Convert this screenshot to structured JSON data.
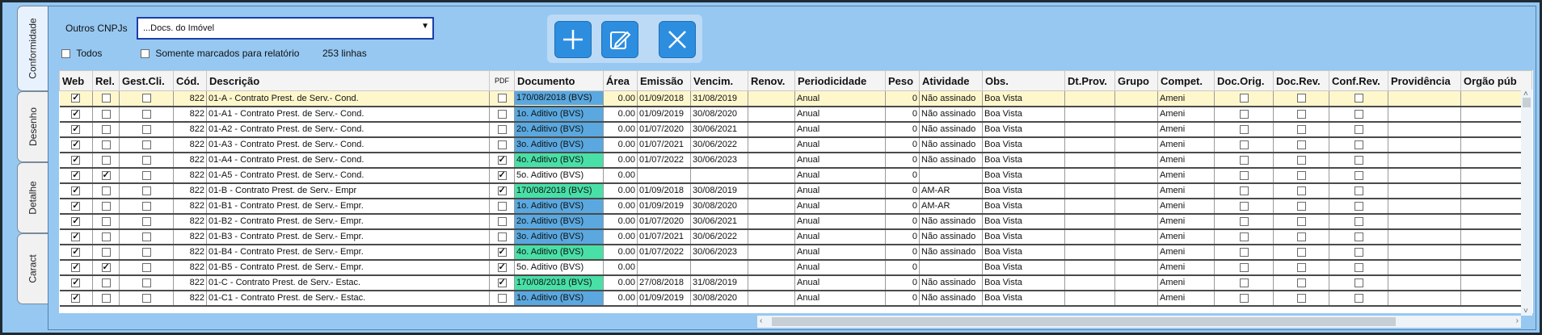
{
  "tabs": [
    {
      "label": "Conformidade",
      "active": true
    },
    {
      "label": "Desenho",
      "active": false
    },
    {
      "label": "Detalhe",
      "active": false
    },
    {
      "label": "Caract",
      "active": false
    }
  ],
  "filters": {
    "cnpj_label": "Outros CNPJs",
    "cnpj_value": "...Docs. do Imóvel",
    "todos_label": "Todos",
    "somente_label": "Somente marcados para relatório",
    "row_count": "253 linhas"
  },
  "toolbar": {
    "add": "plus-icon",
    "edit": "edit-icon",
    "close": "close-icon"
  },
  "colors": {
    "selected_row": "#fff7cc",
    "doc_blue": "#5aa8df",
    "doc_green": "#49e0a8",
    "background": "#96c8f2"
  },
  "columns": [
    "Web",
    "Rel.",
    "Gest.Cli.",
    "Cód.",
    "Descrição",
    "PDF",
    "Documento",
    "Área",
    "Emissão",
    "Vencim.",
    "Renov.",
    "Periodicidade",
    "Peso",
    "Atividade",
    "Obs.",
    "Dt.Prov.",
    "Grupo",
    "Compet.",
    "Doc.Orig.",
    "Doc.Rev.",
    "Conf.Rev.",
    "Providência",
    "Orgão púb"
  ],
  "rows": [
    {
      "web": true,
      "rel": false,
      "cod": "822",
      "desc": "01-A - Contrato Prest. de Serv.- Cond.",
      "pdf": false,
      "doc": "170/08/2018 (BVS)",
      "hl": "blue",
      "area": "0.00",
      "emissao": "01/09/2018",
      "venc": "31/08/2019",
      "period": "Anual",
      "peso": "0",
      "ativ": "Não assinado",
      "obs": "Boa Vista",
      "compet": "Ameni"
    },
    {
      "web": true,
      "rel": false,
      "cod": "822",
      "desc": "01-A1 - Contrato Prest. de Serv.- Cond.",
      "pdf": false,
      "doc": "1o. Aditivo (BVS)",
      "hl": "blue",
      "area": "0.00",
      "emissao": "01/09/2019",
      "venc": "30/08/2020",
      "period": "Anual",
      "peso": "0",
      "ativ": "Não assinado",
      "obs": "Boa Vista",
      "compet": "Ameni"
    },
    {
      "web": true,
      "rel": false,
      "cod": "822",
      "desc": "01-A2 - Contrato Prest. de Serv.- Cond.",
      "pdf": false,
      "doc": "2o. Aditivo (BVS)",
      "hl": "blue",
      "area": "0.00",
      "emissao": "01/07/2020",
      "venc": "30/06/2021",
      "period": "Anual",
      "peso": "0",
      "ativ": "Não assinado",
      "obs": "Boa Vista",
      "compet": "Ameni"
    },
    {
      "web": true,
      "rel": false,
      "cod": "822",
      "desc": "01-A3 - Contrato Prest. de Serv.- Cond.",
      "pdf": false,
      "doc": "3o. Aditivo (BVS)",
      "hl": "blue",
      "area": "0.00",
      "emissao": "01/07/2021",
      "venc": "30/06/2022",
      "period": "Anual",
      "peso": "0",
      "ativ": "Não assinado",
      "obs": "Boa Vista",
      "compet": "Ameni"
    },
    {
      "web": true,
      "rel": false,
      "cod": "822",
      "desc": "01-A4 - Contrato Prest. de Serv.- Cond.",
      "pdf": true,
      "doc": "4o. Aditivo (BVS)",
      "hl": "green",
      "area": "0.00",
      "emissao": "01/07/2022",
      "venc": "30/06/2023",
      "period": "Anual",
      "peso": "0",
      "ativ": "Não assinado",
      "obs": "Boa Vista",
      "compet": "Ameni"
    },
    {
      "web": true,
      "rel": true,
      "cod": "822",
      "desc": "01-A5 - Contrato Prest. de Serv.- Cond.",
      "pdf": true,
      "doc": "5o. Aditivo (BVS)",
      "hl": "",
      "area": "0.00",
      "emissao": "",
      "venc": "",
      "period": "Anual",
      "peso": "0",
      "ativ": "",
      "obs": "Boa Vista",
      "compet": "Ameni"
    },
    {
      "web": true,
      "rel": false,
      "cod": "822",
      "desc": "01-B - Contrato Prest. de Serv.- Empr",
      "pdf": true,
      "doc": "170/08/2018 (BVS)",
      "hl": "green",
      "area": "0.00",
      "emissao": "01/09/2018",
      "venc": "30/08/2019",
      "period": "Anual",
      "peso": "0",
      "ativ": "AM-AR",
      "obs": "Boa Vista",
      "compet": "Ameni"
    },
    {
      "web": true,
      "rel": false,
      "cod": "822",
      "desc": "01-B1 - Contrato Prest. de Serv.- Empr.",
      "pdf": false,
      "doc": "1o. Aditivo (BVS)",
      "hl": "blue",
      "area": "0.00",
      "emissao": "01/09/2019",
      "venc": "30/08/2020",
      "period": "Anual",
      "peso": "0",
      "ativ": "AM-AR",
      "obs": "Boa Vista",
      "compet": "Ameni"
    },
    {
      "web": true,
      "rel": false,
      "cod": "822",
      "desc": "01-B2 - Contrato Prest. de Serv.- Empr.",
      "pdf": false,
      "doc": "2o. Aditivo (BVS)",
      "hl": "blue",
      "area": "0.00",
      "emissao": "01/07/2020",
      "venc": "30/06/2021",
      "period": "Anual",
      "peso": "0",
      "ativ": "Não assinado",
      "obs": "Boa Vista",
      "compet": "Ameni"
    },
    {
      "web": true,
      "rel": false,
      "cod": "822",
      "desc": "01-B3 - Contrato Prest. de Serv.- Empr.",
      "pdf": false,
      "doc": "3o. Aditivo (BVS)",
      "hl": "blue",
      "area": "0.00",
      "emissao": "01/07/2021",
      "venc": "30/06/2022",
      "period": "Anual",
      "peso": "0",
      "ativ": "Não assinado",
      "obs": "Boa Vista",
      "compet": "Ameni"
    },
    {
      "web": true,
      "rel": false,
      "cod": "822",
      "desc": "01-B4 - Contrato Prest. de Serv.- Empr.",
      "pdf": true,
      "doc": "4o. Aditivo (BVS)",
      "hl": "green",
      "area": "0.00",
      "emissao": "01/07/2022",
      "venc": "30/06/2023",
      "period": "Anual",
      "peso": "0",
      "ativ": "Não assinado",
      "obs": "Boa Vista",
      "compet": "Ameni"
    },
    {
      "web": true,
      "rel": true,
      "cod": "822",
      "desc": "01-B5 - Contrato Prest. de Serv.- Empr.",
      "pdf": true,
      "doc": "5o. Aditivo (BVS)",
      "hl": "",
      "area": "0.00",
      "emissao": "",
      "venc": "",
      "period": "Anual",
      "peso": "0",
      "ativ": "",
      "obs": "Boa Vista",
      "compet": "Ameni"
    },
    {
      "web": true,
      "rel": false,
      "cod": "822",
      "desc": "01-C - Contrato Prest. de Serv.- Estac.",
      "pdf": true,
      "doc": "170/08/2018 (BVS)",
      "hl": "green",
      "area": "0.00",
      "emissao": "27/08/2018",
      "venc": "31/08/2019",
      "period": "Anual",
      "peso": "0",
      "ativ": "Não assinado",
      "obs": "Boa Vista",
      "compet": "Ameni"
    },
    {
      "web": true,
      "rel": false,
      "cod": "822",
      "desc": "01-C1 - Contrato Prest. de Serv.- Estac.",
      "pdf": false,
      "doc": "1o. Aditivo (BVS)",
      "hl": "blue",
      "area": "0.00",
      "emissao": "01/09/2019",
      "venc": "30/08/2020",
      "period": "Anual",
      "peso": "0",
      "ativ": "Não assinado",
      "obs": "Boa Vista",
      "compet": "Ameni"
    }
  ]
}
